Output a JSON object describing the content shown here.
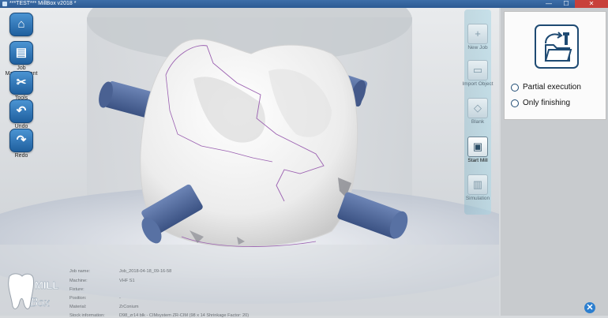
{
  "window": {
    "title": "***TEST*** MillBox v2018 *",
    "minimize_glyph": "—",
    "maximize_glyph": "☐",
    "close_glyph": "✕"
  },
  "left_toolbar": [
    {
      "label": "",
      "icon": "home-icon",
      "glyph": "⌂"
    },
    {
      "label": "Job Management",
      "icon": "job-management-icon",
      "glyph": "▤"
    },
    {
      "label": "Tools",
      "icon": "tools-icon",
      "glyph": "✂"
    },
    {
      "label": "Undo",
      "icon": "undo-icon",
      "glyph": "↶"
    },
    {
      "label": "Redo",
      "icon": "redo-icon",
      "glyph": "↷"
    }
  ],
  "right_toolbar": [
    {
      "label": "New Job",
      "icon": "new-job-icon",
      "glyph": "+",
      "active": false
    },
    {
      "label": "Import Object",
      "icon": "import-object-icon",
      "glyph": "▭",
      "active": false
    },
    {
      "label": "Blank",
      "icon": "blank-icon",
      "glyph": "◇",
      "active": false
    },
    {
      "label": "Start Mill",
      "icon": "start-mill-icon",
      "glyph": "▣",
      "active": true
    },
    {
      "label": "Simulation",
      "icon": "simulation-icon",
      "glyph": "▥",
      "active": false
    }
  ],
  "options_panel": {
    "icon": "milling-folder-icon",
    "options": [
      {
        "label": "Partial execution",
        "checked": false
      },
      {
        "label": "Only finishing",
        "checked": false
      }
    ]
  },
  "job_info": [
    {
      "key": "Job name:",
      "value": "Job_2018-04-18_09-16-58"
    },
    {
      "key": "Machine:",
      "value": "VHF S1"
    },
    {
      "key": "Fixture:",
      "value": ""
    },
    {
      "key": "Position:",
      "value": "-"
    },
    {
      "key": "Material:",
      "value": "ZrConium"
    },
    {
      "key": "Stock information:",
      "value": "D98_zr14 blk - CIMsystem ZR-CIM (98 x 14 Shrinkage Factor: 20)"
    }
  ],
  "logo": {
    "line1": "MILL",
    "line2": "Box"
  },
  "colors": {
    "accent": "#2d7fcf",
    "sprue": "#4f6796",
    "tooth": "#eeeeee",
    "outline": "#9a5fb0"
  }
}
